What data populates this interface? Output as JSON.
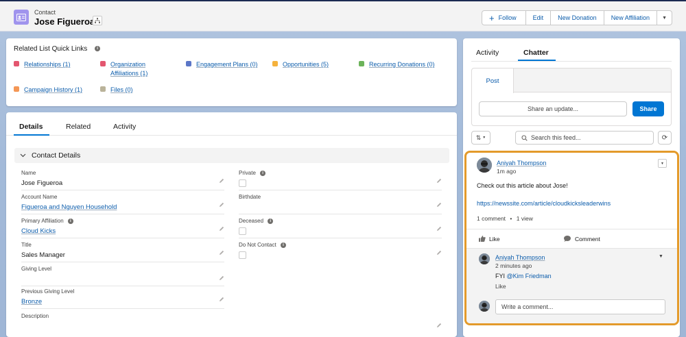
{
  "header": {
    "object_label": "Contact",
    "record_name": "Jose Figueroa",
    "buttons": [
      {
        "label": "Follow",
        "icon": "plus-icon"
      },
      {
        "label": "Edit"
      },
      {
        "label": "New Donation"
      },
      {
        "label": "New Affiliation"
      }
    ]
  },
  "quick_links": {
    "title": "Related List Quick Links",
    "items": [
      {
        "label": "Relationships (1)",
        "color": "#e3566f"
      },
      {
        "label": "Organization Affiliations (1)",
        "color": "#e3566f"
      },
      {
        "label": "Engagement Plans (0)",
        "color": "#5b76c7"
      },
      {
        "label": "Opportunities (5)",
        "color": "#f5b23d"
      },
      {
        "label": "Recurring Donations (0)",
        "color": "#6cb35a"
      },
      {
        "label": "Campaign History (1)",
        "color": "#f49756"
      },
      {
        "label": "Files (0)",
        "color": "#bab39a"
      }
    ]
  },
  "details": {
    "tabs": [
      "Details",
      "Related",
      "Activity"
    ],
    "section_title": "Contact Details",
    "left_fields": [
      {
        "label": "Name",
        "value": "Jose Figueroa",
        "link": false
      },
      {
        "label": "Account Name",
        "value": "Figueroa and Nguyen Household",
        "link": true
      },
      {
        "label": "Primary Affiliation",
        "value": "Cloud Kicks",
        "link": true,
        "info": true
      },
      {
        "label": "Title",
        "value": "Sales Manager",
        "link": false
      },
      {
        "label": "Giving Level",
        "value": "",
        "link": false
      },
      {
        "label": "Previous Giving Level",
        "value": "Bronze",
        "link": true
      },
      {
        "label": "Description",
        "value": "",
        "link": false
      }
    ],
    "right_fields": [
      {
        "label": "Private",
        "type": "checkbox",
        "info": true
      },
      {
        "label": "Birthdate",
        "type": "text",
        "value": ""
      },
      {
        "label": "Deceased",
        "type": "checkbox",
        "info": true
      },
      {
        "label": "Do Not Contact",
        "type": "checkbox",
        "info": true
      }
    ]
  },
  "sidebar": {
    "tabs": [
      "Activity",
      "Chatter"
    ],
    "active_tab": "Chatter",
    "post_tab": "Post",
    "share_placeholder": "Share an update...",
    "share_button": "Share",
    "search_placeholder": "Search this feed..."
  },
  "feed_item": {
    "author": "Aniyah Thompson",
    "time": "1m ago",
    "text": "Check out this article about Jose!",
    "url": "https://newssite.com/article/cloudkicksleaderwins",
    "stats_comments": "1 comment",
    "stats_sep": "•",
    "stats_views": "1 view",
    "like_label": "Like",
    "comment_label": "Comment",
    "comment": {
      "author": "Aniyah Thompson",
      "time": "2 minutes ago",
      "text_prefix": "FYI",
      "mention": "@Kim Friedman",
      "like": "Like"
    },
    "comment_placeholder": "Write a comment..."
  }
}
